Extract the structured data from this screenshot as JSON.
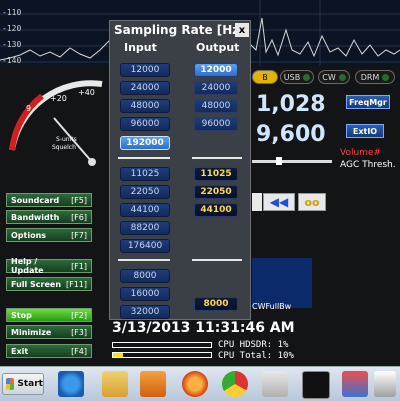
{
  "spectrum": {
    "db_labels": [
      "-110",
      "-120",
      "-130",
      "-140"
    ]
  },
  "meter": {
    "scale_labels": [
      "+20",
      "+40",
      "9"
    ],
    "caption_line1": "S-units",
    "caption_line2": "Squelch"
  },
  "left_buttons": [
    {
      "label": "Soundcard",
      "key": "[F5]"
    },
    {
      "label": "Bandwidth",
      "key": "[F6]"
    },
    {
      "label": "Options",
      "key": "[F7]"
    },
    {
      "label": "Help / Update",
      "key": "[F1]"
    },
    {
      "label": "Full Screen",
      "key": "[F11]"
    },
    {
      "label": "Stop",
      "key": "[F2]"
    },
    {
      "label": "Minimize",
      "key": "[F3]"
    },
    {
      "label": "Exit",
      "key": "[F4]"
    }
  ],
  "modes": {
    "b": "B",
    "usb": "USB",
    "cw": "CW",
    "drm": "DRM"
  },
  "frequency": {
    "main": "1,028",
    "second": "9,600"
  },
  "right_buttons": {
    "freqmgr": "FreqMgr",
    "extio": "ExtIO"
  },
  "labels": {
    "volume": "Volume#",
    "agc": "AGC Thresh.",
    "cwfullbw": "CWFullBw"
  },
  "dialog": {
    "title": "Sampling Rate [Hz]",
    "close": "x",
    "input_header": "Input",
    "output_header": "Output",
    "input_rates": [
      "12000",
      "24000",
      "48000",
      "96000",
      "192000",
      "11025",
      "22050",
      "44100",
      "88200",
      "176400",
      "8000",
      "16000",
      "32000"
    ],
    "selected_input": "192000",
    "output_rates": [
      "12000",
      "24000",
      "48000",
      "96000",
      "11025",
      "22050",
      "44100",
      "8000"
    ],
    "selected_output": "12000"
  },
  "status": {
    "datetime": "3/13/2013 11:31:46 AM",
    "cpu_hdsdr": "CPU HDSDR: 1%",
    "cpu_total": "CPU Total: 10%"
  },
  "taskbar": {
    "start": "Start",
    "icons": [
      "internet-explorer-icon",
      "file-explorer-icon",
      "media-player-icon",
      "firefox-icon",
      "chrome-icon",
      "paint-icon",
      "command-prompt-icon",
      "network-icon",
      "hdsdr-icon"
    ]
  },
  "colors": {
    "accent": "#2d6fd0",
    "output_text": "#ffd84a",
    "stop_green": "#6dde3a"
  }
}
